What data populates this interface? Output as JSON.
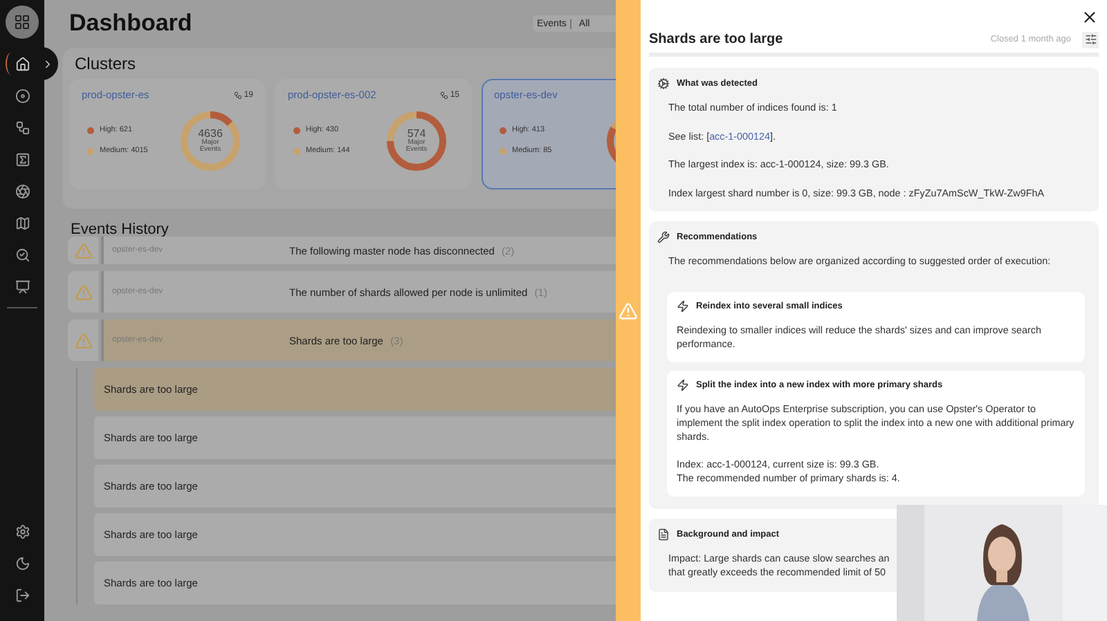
{
  "sidebar": {
    "items": [
      {
        "selected": true
      },
      {
        "selected": false
      },
      {
        "selected": false
      },
      {
        "selected": false
      },
      {
        "selected": false
      },
      {
        "selected": false
      },
      {
        "selected": false
      },
      {
        "selected": false
      }
    ],
    "bottom_items": [
      {
        "selected": false
      },
      {
        "selected": false
      },
      {
        "selected": false
      }
    ]
  },
  "header": {
    "title": "Dashboard",
    "filter": {
      "label": "Events",
      "value": "All"
    }
  },
  "clusters": {
    "title": "Clusters",
    "items": [
      {
        "name": "prod-opster-es",
        "count": "19",
        "high": "High: 621",
        "medium": "Medium: 4015",
        "total": "4636",
        "total_label": "Major Events",
        "selected": false
      },
      {
        "name": "prod-opster-es-002",
        "count": "15",
        "high": "High: 430",
        "medium": "Medium: 144",
        "total": "574",
        "total_label": "Major Events",
        "selected": false
      },
      {
        "name": "opster-es-dev",
        "high": "High: 413",
        "medium": "Medium: 85",
        "selected": true
      }
    ]
  },
  "events_history": {
    "title": "Events History",
    "rows": [
      {
        "cluster": "opster-es-dev",
        "message": "The following master node has disconnected",
        "count": "(2)",
        "expanded": false
      },
      {
        "cluster": "opster-es-dev",
        "message": "The number of shards allowed per node is unlimited",
        "count": "(1)",
        "expanded": false
      },
      {
        "cluster": "opster-es-dev",
        "message": "Shards are too large",
        "count": "(3)",
        "expanded": true,
        "children": [
          {
            "message": "Shards are too large",
            "selected": true
          },
          {
            "message": "Shards are too large",
            "selected": false
          },
          {
            "message": "Shards are too large",
            "selected": false
          },
          {
            "message": "Shards are too large",
            "selected": false
          },
          {
            "message": "Shards are too large",
            "selected": false
          }
        ]
      }
    ]
  },
  "detail": {
    "title": "Shards are too large",
    "status": "Closed 1 month ago",
    "sections": [
      {
        "kind": "detected",
        "title": "What was detected",
        "paragraphs": [
          {
            "text": "The total number of indices found is: 1"
          },
          {
            "text": "See list: [",
            "link": "acc-1-000124",
            "after": "]."
          },
          {
            "text": "The largest index is: acc-1-000124, size: 99.3 GB."
          },
          {
            "text": "Index largest shard number is 0, size: 99.3 GB, node : zFyZu7AmScW_TkW-Zw9FhA"
          }
        ]
      },
      {
        "kind": "recommendations",
        "title": "Recommendations",
        "intro": "The recommendations below are organized according to suggested order of execution:",
        "items": [
          {
            "title": "Reindex into several small indices",
            "paragraphs": [
              [
                "Reindexing to smaller indices will reduce the shards' sizes and can improve search performance."
              ]
            ]
          },
          {
            "title": "Split the index into a new index with more primary shards",
            "paragraphs": [
              [
                "If you have an AutoOps Enterprise subscription, you can use Opster's Operator to implement the split index operation to split the index into a new one with additional primary shards."
              ],
              [
                "Index: acc-1-000124, current size is: 99.3 GB.",
                "The recommended number of primary shards is: 4."
              ]
            ]
          }
        ]
      },
      {
        "kind": "background",
        "title": "Background and impact",
        "lines": [
          "Impact: Large shards can cause slow searches an",
          "that greatly exceeds the recommended limit of 50"
        ]
      }
    ]
  }
}
